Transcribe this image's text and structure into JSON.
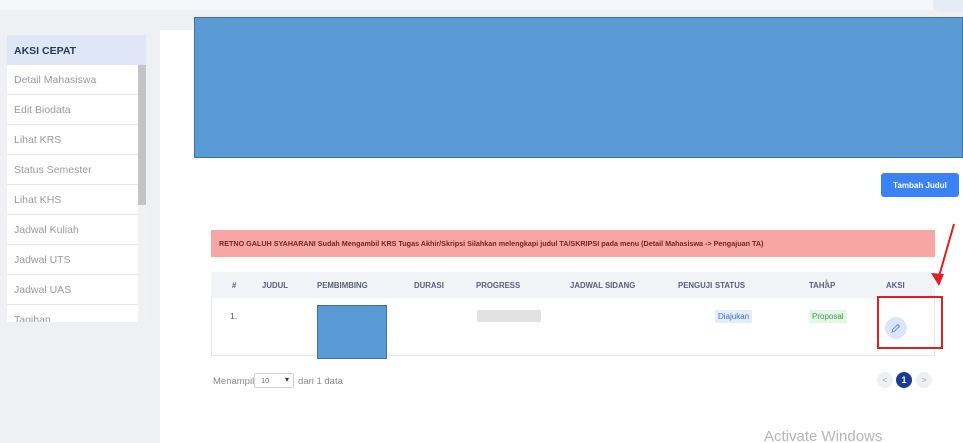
{
  "sidebar": {
    "header": "AKSI CEPAT",
    "items": [
      {
        "label": "Detail Mahasiswa"
      },
      {
        "label": "Edit Biodata"
      },
      {
        "label": "Lihat KRS"
      },
      {
        "label": "Status Semester"
      },
      {
        "label": "Lihat KHS"
      },
      {
        "label": "Jadwal Kuliah"
      },
      {
        "label": "Jadwal UTS"
      },
      {
        "label": "Jadwal UAS"
      },
      {
        "label": "Tagihan"
      }
    ]
  },
  "actions": {
    "add_title_label": "Tambah Judul"
  },
  "alert": {
    "text": "RETNO GALUH SYAHARANI Sudah Mengambil KRS Tugas Akhir/Skripsi Silahkan melengkapi judul TA/SKRIPSI pada menu (Detail Mahasiswa -> Pengajuan TA)"
  },
  "table": {
    "columns": [
      "#",
      "JUDUL",
      "PEMBIMBING",
      "DURASI",
      "PROGRESS",
      "JADWAL SIDANG",
      "PENGUJI",
      "STATUS",
      "TAHAP",
      "AKSI"
    ],
    "rows": [
      {
        "no": "1.",
        "progress": 0,
        "status": "Diajukan",
        "tahap": "Proposal"
      }
    ]
  },
  "footer": {
    "show_label": "Menampilkan",
    "page_size": "10",
    "count_text": "dari 1 data"
  },
  "pagination": {
    "prev": "<",
    "current": "1",
    "next": ">"
  },
  "watermark": "Activate Windows",
  "colors": {
    "primary": "#3b82f6",
    "alert_bg": "#f8a5a5",
    "highlight": "#e02020",
    "redacted_block": "#5b9bd5"
  },
  "icons": {
    "edit": "pencil-icon",
    "dropdown": "chevron-down-icon",
    "sort": "sort-icon"
  }
}
